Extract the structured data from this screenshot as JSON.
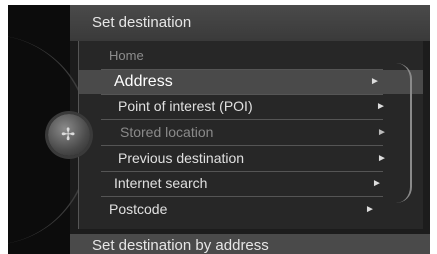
{
  "header": {
    "title": "Set destination"
  },
  "menu": {
    "items": [
      {
        "label": "Home",
        "state": "dim-heading"
      },
      {
        "label": "Address",
        "state": "selected"
      },
      {
        "label": "Point of interest (POI)",
        "state": "normal"
      },
      {
        "label": "Stored location",
        "state": "disabled"
      },
      {
        "label": "Previous destination",
        "state": "normal"
      },
      {
        "label": "Internet search",
        "state": "normal"
      },
      {
        "label": "Postcode",
        "state": "normal"
      }
    ],
    "arrow_glyph": "►"
  },
  "knob": {
    "icon": "compass-icon",
    "glyph": "✢"
  },
  "footer": {
    "label": "Set destination by address"
  }
}
